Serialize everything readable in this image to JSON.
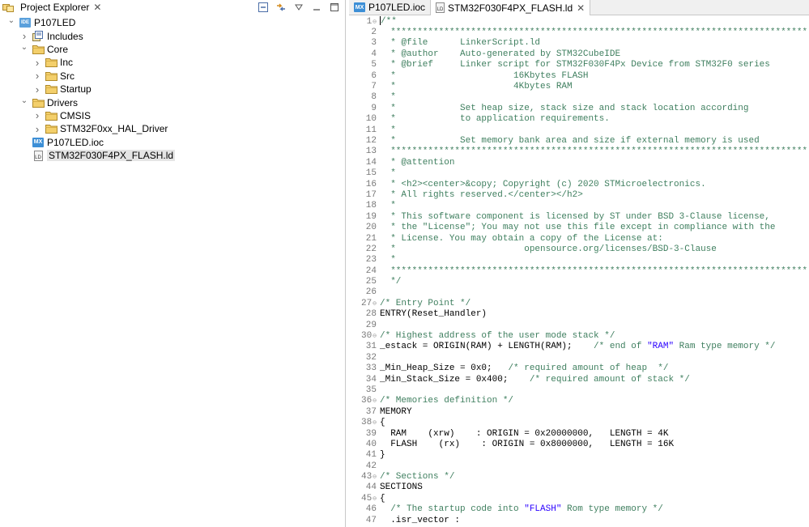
{
  "explorer": {
    "title": "Project Explorer",
    "items": [
      {
        "label": "P107LED",
        "icon": "ide-project-icon",
        "level": 0,
        "twisty": "expanded"
      },
      {
        "label": "Includes",
        "icon": "includes-icon",
        "level": 1,
        "twisty": "collapsed"
      },
      {
        "label": "Core",
        "icon": "folder-icon",
        "level": 1,
        "twisty": "expanded"
      },
      {
        "label": "Inc",
        "icon": "folder-icon",
        "level": 2,
        "twisty": "collapsed"
      },
      {
        "label": "Src",
        "icon": "folder-icon",
        "level": 2,
        "twisty": "collapsed"
      },
      {
        "label": "Startup",
        "icon": "folder-icon",
        "level": 2,
        "twisty": "collapsed"
      },
      {
        "label": "Drivers",
        "icon": "folder-icon",
        "level": 1,
        "twisty": "expanded"
      },
      {
        "label": "CMSIS",
        "icon": "folder-icon",
        "level": 2,
        "twisty": "collapsed"
      },
      {
        "label": "STM32F0xx_HAL_Driver",
        "icon": "folder-icon",
        "level": 2,
        "twisty": "collapsed"
      },
      {
        "label": "P107LED.ioc",
        "icon": "mx-file-icon",
        "level": 1,
        "twisty": "none"
      },
      {
        "label": "STM32F030F4PX_FLASH.ld",
        "icon": "ld-file-icon",
        "level": 1,
        "twisty": "none",
        "selected": true
      }
    ]
  },
  "editor": {
    "tabs": [
      {
        "label": "P107LED.ioc",
        "icon": "mx-file-icon",
        "active": false
      },
      {
        "label": "STM32F030F4PX_FLASH.ld",
        "icon": "ld-file-icon",
        "active": true
      }
    ],
    "lines": [
      {
        "n": "1",
        "t": "/**",
        "c": "cm",
        "fold": true
      },
      {
        "n": "2",
        "t": "  ******************************************************************************",
        "c": "cm"
      },
      {
        "n": "3",
        "t": "  * @file      LinkerScript.ld",
        "c": "cm"
      },
      {
        "n": "4",
        "t": "  * @author    Auto-generated by STM32CubeIDE",
        "c": "cm"
      },
      {
        "n": "5",
        "t": "  * @brief     Linker script for STM32F030F4Px Device from STM32F0 series",
        "c": "cm"
      },
      {
        "n": "6",
        "t": "  *                      16Kbytes FLASH",
        "c": "cm"
      },
      {
        "n": "7",
        "t": "  *                      4Kbytes RAM",
        "c": "cm"
      },
      {
        "n": "8",
        "t": "  *",
        "c": "cm"
      },
      {
        "n": "9",
        "t": "  *            Set heap size, stack size and stack location according",
        "c": "cm"
      },
      {
        "n": "10",
        "t": "  *            to application requirements.",
        "c": "cm"
      },
      {
        "n": "11",
        "t": "  *",
        "c": "cm"
      },
      {
        "n": "12",
        "t": "  *            Set memory bank area and size if external memory is used",
        "c": "cm"
      },
      {
        "n": "13",
        "t": "  ******************************************************************************",
        "c": "cm"
      },
      {
        "n": "14",
        "t": "  * @attention",
        "c": "cm"
      },
      {
        "n": "15",
        "t": "  *",
        "c": "cm"
      },
      {
        "n": "16",
        "t": "  * <h2><center>&copy; Copyright (c) 2020 STMicroelectronics.",
        "c": "cm"
      },
      {
        "n": "17",
        "t": "  * All rights reserved.</center></h2>",
        "c": "cm"
      },
      {
        "n": "18",
        "t": "  *",
        "c": "cm"
      },
      {
        "n": "19",
        "t": "  * This software component is licensed by ST under BSD 3-Clause license,",
        "c": "cm"
      },
      {
        "n": "20",
        "t": "  * the \"License\"; You may not use this file except in compliance with the",
        "c": "cm"
      },
      {
        "n": "21",
        "t": "  * License. You may obtain a copy of the License at:",
        "c": "cm"
      },
      {
        "n": "22",
        "t": "  *                        opensource.org/licenses/BSD-3-Clause",
        "c": "cm"
      },
      {
        "n": "23",
        "t": "  *",
        "c": "cm"
      },
      {
        "n": "24",
        "t": "  ******************************************************************************",
        "c": "cm"
      },
      {
        "n": "25",
        "t": "  */",
        "c": "cm"
      },
      {
        "n": "26",
        "t": "",
        "c": "kw"
      },
      {
        "n": "27",
        "t": "/* Entry Point */",
        "c": "cm",
        "fold": true
      },
      {
        "n": "28",
        "t": "ENTRY(Reset_Handler)",
        "c": "kw"
      },
      {
        "n": "29",
        "t": "",
        "c": "kw"
      },
      {
        "n": "30",
        "t": "/* Highest address of the user mode stack */",
        "c": "cm",
        "fold": true
      },
      {
        "n": "31",
        "t": "_estack = ORIGIN(RAM) + LENGTH(RAM);    /* end of \"RAM\" Ram type memory */",
        "c": "mix1"
      },
      {
        "n": "32",
        "t": "",
        "c": "kw"
      },
      {
        "n": "33",
        "t": "_Min_Heap_Size = 0x0;   /* required amount of heap  */",
        "c": "mix2"
      },
      {
        "n": "34",
        "t": "_Min_Stack_Size = 0x400;    /* required amount of stack */",
        "c": "mix3"
      },
      {
        "n": "35",
        "t": "",
        "c": "kw"
      },
      {
        "n": "36",
        "t": "/* Memories definition */",
        "c": "cm",
        "fold": true
      },
      {
        "n": "37",
        "t": "MEMORY",
        "c": "kw"
      },
      {
        "n": "38",
        "t": "{",
        "c": "kw",
        "fold": true
      },
      {
        "n": "39",
        "t": "  RAM    (xrw)    : ORIGIN = 0x20000000,   LENGTH = 4K",
        "c": "kw"
      },
      {
        "n": "40",
        "t": "  FLASH    (rx)    : ORIGIN = 0x8000000,   LENGTH = 16K",
        "c": "kw"
      },
      {
        "n": "41",
        "t": "}",
        "c": "kw"
      },
      {
        "n": "42",
        "t": "",
        "c": "kw"
      },
      {
        "n": "43",
        "t": "/* Sections */",
        "c": "cm",
        "fold": true
      },
      {
        "n": "44",
        "t": "SECTIONS",
        "c": "kw"
      },
      {
        "n": "45",
        "t": "{",
        "c": "kw",
        "fold": true
      },
      {
        "n": "46",
        "t": "  /* The startup code into \"FLASH\" Rom type memory */",
        "c": "mix4"
      },
      {
        "n": "47",
        "t": "  .isr_vector :",
        "c": "kw"
      }
    ]
  }
}
